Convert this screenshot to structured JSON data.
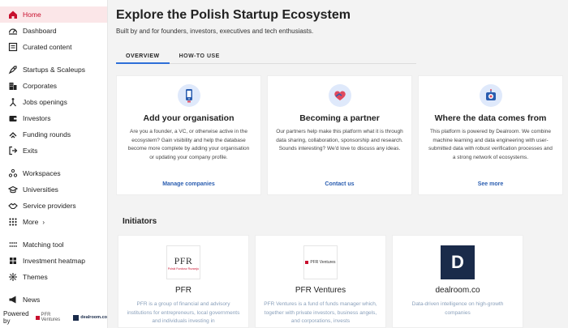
{
  "sidebar": {
    "items": [
      {
        "label": "Home",
        "icon": "home-icon"
      },
      {
        "label": "Dashboard",
        "icon": "dashboard-icon"
      },
      {
        "label": "Curated content",
        "icon": "curated-icon"
      },
      {
        "label": "Startups & Scaleups",
        "icon": "rocket-icon"
      },
      {
        "label": "Corporates",
        "icon": "building-icon"
      },
      {
        "label": "Jobs openings",
        "icon": "jobs-icon"
      },
      {
        "label": "Investors",
        "icon": "wallet-icon"
      },
      {
        "label": "Funding rounds",
        "icon": "funding-icon"
      },
      {
        "label": "Exits",
        "icon": "exit-icon"
      },
      {
        "label": "Workspaces",
        "icon": "workspace-icon"
      },
      {
        "label": "Universities",
        "icon": "graduation-icon"
      },
      {
        "label": "Service providers",
        "icon": "handshake-icon"
      },
      {
        "label": "More",
        "icon": "grid-icon"
      },
      {
        "label": "Matching tool",
        "icon": "matching-icon"
      },
      {
        "label": "Investment heatmap",
        "icon": "heatmap-icon"
      },
      {
        "label": "Themes",
        "icon": "themes-icon"
      },
      {
        "label": "News",
        "icon": "megaphone-icon"
      }
    ],
    "powered_by": "Powered by",
    "partner_pfr": "PFR Ventures",
    "partner_dealroom": "dealroom.co"
  },
  "header": {
    "title": "Explore the Polish Startup Ecosystem",
    "subtitle": "Built by and for founders, investors, executives and tech enthusiasts."
  },
  "tabs": [
    {
      "label": "OVERVIEW",
      "active": true
    },
    {
      "label": "HOW-TO USE",
      "active": false
    }
  ],
  "cards": [
    {
      "title": "Add your organisation",
      "text": "Are you a founder, a VC, or otherwise active in the ecosystem? Gain visibility and help the database become more complete by adding your organisation or updating your company profile.",
      "link": "Manage companies"
    },
    {
      "title": "Becoming a partner",
      "text": "Our partners help make this platform what it is through data sharing, collaboration, sponsorship and research. Sounds interesting? We'd love to discuss any ideas.",
      "link": "Contact us"
    },
    {
      "title": "Where the data comes from",
      "text": "This platform is powered by Dealroom. We combine machine learning and data engineering with user-submitted data with robust verification processes and a strong network of ecosystems.",
      "link": "See more"
    }
  ],
  "initiators": {
    "heading": "Initiators",
    "items": [
      {
        "name": "PFR",
        "logo_text": "PFR",
        "logo_subtext": "Polski Fundusz Rozwoju",
        "text": "PFR is a group of financial and advisory institutions for entrepreneurs, local governments and individuals investing in"
      },
      {
        "name": "PFR Ventures",
        "logo_text": "PFR Ventures",
        "text": "PFR Ventures is a fund of funds manager which, together with private investors, business angels, and corporations, invests"
      },
      {
        "name": "dealroom.co",
        "logo_text": "D",
        "text": "Data-driven intelligence on high-growth companies"
      }
    ]
  },
  "colors": {
    "accent_red": "#c8102e",
    "active_bg": "#fbe6e8",
    "link_blue": "#2a5db0",
    "tab_underline": "#2e6fd8",
    "dealroom_navy": "#1a2b4a"
  }
}
